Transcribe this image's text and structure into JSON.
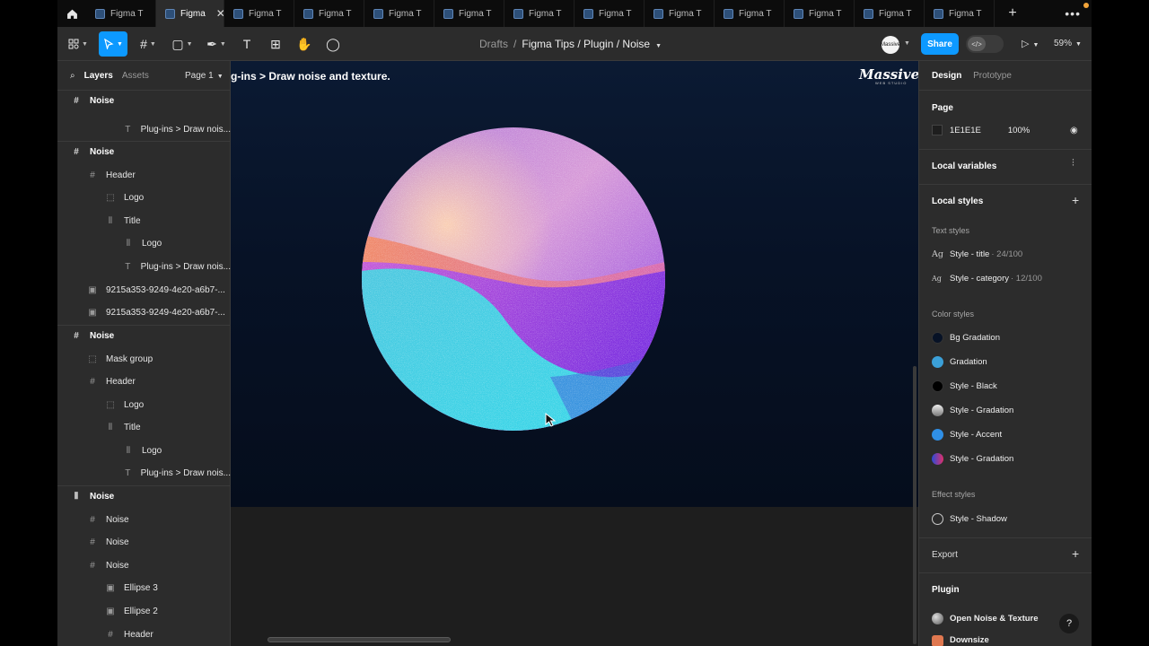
{
  "tabs": {
    "items": [
      {
        "label": "Figma T",
        "active": false
      },
      {
        "label": "Figma",
        "active": true
      },
      {
        "label": "Figma T",
        "active": false
      },
      {
        "label": "Figma T",
        "active": false
      },
      {
        "label": "Figma T",
        "active": false
      },
      {
        "label": "Figma T",
        "active": false
      },
      {
        "label": "Figma T",
        "active": false
      },
      {
        "label": "Figma T",
        "active": false
      },
      {
        "label": "Figma T",
        "active": false
      },
      {
        "label": "Figma T",
        "active": false
      },
      {
        "label": "Figma T",
        "active": false
      },
      {
        "label": "Figma T",
        "active": false
      },
      {
        "label": "Figma T",
        "active": false
      }
    ],
    "close_glyph": "✕",
    "plus_glyph": "+",
    "more_glyph": "•••"
  },
  "toolbar": {
    "breadcrumb_root": "Drafts",
    "breadcrumb_sep": "/",
    "file_name": "Figma Tips / Plugin / Noise",
    "avatar_text": "Massive",
    "share_label": "Share",
    "zoom": "59%"
  },
  "left_panel": {
    "tab_layers": "Layers",
    "tab_assets": "Assets",
    "page_label": "Page 1",
    "layers": [
      {
        "label": "Noise",
        "icon": "frame-icon",
        "bold": true
      },
      {
        "label": "Plug-ins > Draw nois...",
        "icon": "text-icon",
        "bold": false
      },
      {
        "label": "Noise",
        "icon": "frame-icon",
        "bold": true
      },
      {
        "label": "Header",
        "icon": "frame-icon",
        "bold": false
      },
      {
        "label": "Logo",
        "icon": "component-icon",
        "bold": false
      },
      {
        "label": "Title",
        "icon": "auto-layout-icon",
        "bold": false
      },
      {
        "label": "Logo",
        "icon": "auto-layout-icon",
        "bold": false
      },
      {
        "label": "Plug-ins > Draw nois...",
        "icon": "text-icon",
        "bold": false
      },
      {
        "label": "9215a353-9249-4e20-a6b7-...",
        "icon": "image-icon",
        "bold": false
      },
      {
        "label": "9215a353-9249-4e20-a6b7-...",
        "icon": "image-icon",
        "bold": false
      },
      {
        "label": "Noise",
        "icon": "frame-icon",
        "bold": true
      },
      {
        "label": "Mask group",
        "icon": "mask-icon",
        "bold": false
      },
      {
        "label": "Header",
        "icon": "frame-icon",
        "bold": false
      },
      {
        "label": "Logo",
        "icon": "component-icon",
        "bold": false
      },
      {
        "label": "Title",
        "icon": "auto-layout-icon",
        "bold": false
      },
      {
        "label": "Logo",
        "icon": "auto-layout-icon",
        "bold": false
      },
      {
        "label": "Plug-ins > Draw nois...",
        "icon": "text-icon",
        "bold": false
      },
      {
        "label": "Noise",
        "icon": "auto-layout-icon",
        "bold": true
      },
      {
        "label": "Noise",
        "icon": "frame-icon",
        "bold": false
      },
      {
        "label": "Noise",
        "icon": "frame-icon",
        "bold": false
      },
      {
        "label": "Noise",
        "icon": "frame-icon",
        "bold": false
      },
      {
        "label": "Ellipse 3",
        "icon": "image-icon",
        "bold": false
      },
      {
        "label": "Ellipse 2",
        "icon": "image-icon",
        "bold": false
      },
      {
        "label": "Header",
        "icon": "frame-icon",
        "bold": false
      }
    ]
  },
  "canvas": {
    "frame_title": "g-ins > Draw noise and texture.",
    "logo_text": "Massive",
    "logo_sub": "WEB STUDIO"
  },
  "right_panel": {
    "tab_design": "Design",
    "tab_prototype": "Prototype",
    "page_heading": "Page",
    "page_color": "1E1E1E",
    "page_opacity": "100%",
    "local_variables": "Local variables",
    "local_styles": "Local styles",
    "text_styles_heading": "Text styles",
    "text_styles": [
      {
        "name": "Style - title",
        "meta": "· 24/100"
      },
      {
        "name": "Style - category",
        "meta": "· 12/100"
      }
    ],
    "color_styles_heading": "Color styles",
    "color_styles": [
      {
        "name": "Bg Gradation",
        "swatch": "#071226"
      },
      {
        "name": "Gradation",
        "swatch": "#3ba0d8"
      },
      {
        "name": "Style - Black",
        "swatch": "#000000"
      },
      {
        "name": "Style - Gradation",
        "swatch": "#bdbdbd"
      },
      {
        "name": "Style - Accent",
        "swatch": "#2f8fe6"
      },
      {
        "name": "Style - Gradation",
        "swatch": "#c23c8c"
      }
    ],
    "effect_styles_heading": "Effect styles",
    "effect_style": "Style - Shadow",
    "export_heading": "Export",
    "plugin_heading": "Plugin",
    "plugin_open": "Open Noise & Texture",
    "plugin_partial": "Downsize",
    "help_glyph": "?"
  },
  "colors": {
    "accent": "#0d99ff",
    "panel_bg": "#2c2c2c",
    "canvas_bg": "#1e1e1e"
  }
}
